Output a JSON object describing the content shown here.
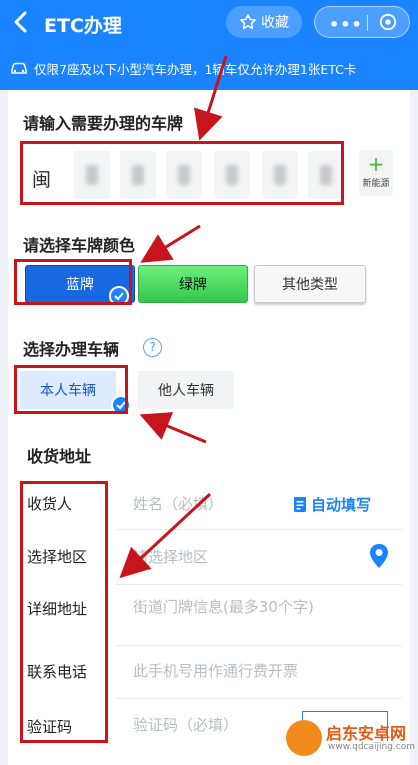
{
  "header": {
    "title": "ETC办理",
    "favorite_label": "收藏",
    "more_label": "•••"
  },
  "notice": {
    "text": "仅限7座及以下小型汽车办理，1辆车仅允许办理1张ETC卡"
  },
  "plate": {
    "label": "请输入需要办理的车牌",
    "province": "闽",
    "new_energy_label": "新能源"
  },
  "plate_color": {
    "label": "请选择车牌颜色",
    "options": [
      "蓝牌",
      "绿牌",
      "其他类型"
    ]
  },
  "vehicle": {
    "label": "选择办理车辆",
    "help": "?",
    "options": [
      "本人车辆",
      "他人车辆"
    ]
  },
  "address": {
    "section_title": "收货地址",
    "auto_fill": "自动填写",
    "fields": [
      {
        "label": "收货人",
        "placeholder": "姓名（必填）"
      },
      {
        "label": "选择地区",
        "placeholder": "请选择地区"
      },
      {
        "label": "详细地址",
        "placeholder": "街道门牌信息(最多30个字)"
      },
      {
        "label": "联系电话",
        "placeholder": "此手机号用作通行费开票"
      },
      {
        "label": "验证码",
        "placeholder": "验证码（必填）"
      }
    ]
  },
  "watermark": {
    "title": "启东安卓网",
    "url": "www.qdcaijing.com"
  },
  "colors": {
    "brand_blue": "#1a83ff",
    "highlight_red": "#c8141c",
    "plate_blue": "#1868e0",
    "plate_green": "#32c84a"
  }
}
